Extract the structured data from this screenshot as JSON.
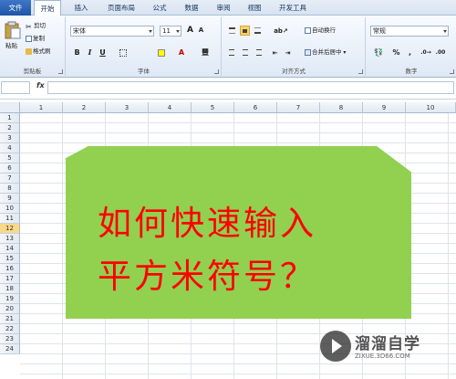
{
  "menubar": {
    "file": "文件",
    "tabs": [
      "开始",
      "插入",
      "页面布局",
      "公式",
      "数据",
      "审阅",
      "视图",
      "开发工具"
    ]
  },
  "ribbon": {
    "clipboard": {
      "label": "剪贴板",
      "paste": "粘贴",
      "cut": "剪切",
      "copy": "复制",
      "format_painter": "格式刷"
    },
    "font": {
      "label": "字体",
      "font_name": "宋体",
      "font_size": "11",
      "bold": "B",
      "italic": "I",
      "underline": "U"
    },
    "alignment": {
      "label": "对齐方式",
      "wrap_text": "自动换行",
      "merge_center": "合并后居中"
    },
    "number": {
      "label": "数字",
      "format": "常规",
      "percent": "%",
      "comma": ","
    }
  },
  "formula_bar": {
    "fx": "fx",
    "value": ""
  },
  "sheet": {
    "columns": [
      "1",
      "2",
      "3",
      "4",
      "5",
      "6",
      "7",
      "8",
      "9",
      "10"
    ],
    "rows": [
      "1",
      "2",
      "3",
      "4",
      "5",
      "6",
      "7",
      "8",
      "9",
      "10",
      "11",
      "12",
      "13",
      "14",
      "15",
      "16",
      "17",
      "18",
      "19",
      "20",
      "21",
      "22",
      "23",
      "24"
    ],
    "selected_row": "12"
  },
  "shape": {
    "line1": "如何快速输入",
    "line2": "平方米符号？",
    "fill_color": "#92d050",
    "text_color": "#ff0000"
  },
  "watermark": {
    "name": "溜溜自学",
    "url": "ZIXUE.3D66.COM"
  }
}
